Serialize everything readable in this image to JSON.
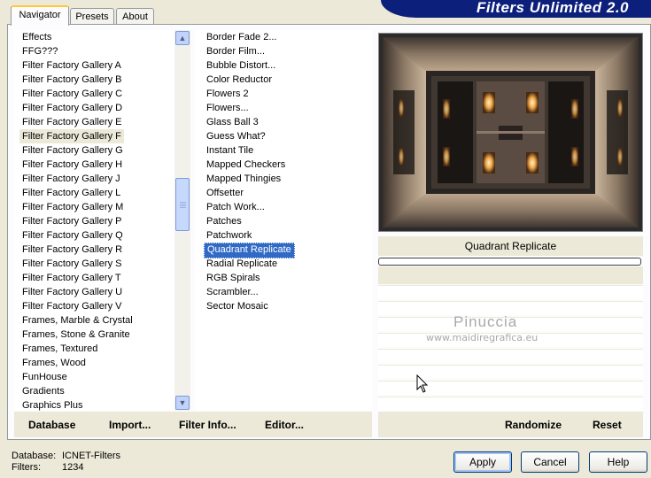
{
  "tabs": [
    {
      "label": "Navigator"
    },
    {
      "label": "Presets"
    },
    {
      "label": "About"
    }
  ],
  "app_title": "Filters Unlimited 2.0",
  "categories": [
    "Effects",
    "FFG???",
    "Filter Factory Gallery A",
    "Filter Factory Gallery B",
    "Filter Factory Gallery C",
    "Filter Factory Gallery D",
    "Filter Factory Gallery E",
    "Filter Factory Gallery F",
    "Filter Factory Gallery G",
    "Filter Factory Gallery H",
    "Filter Factory Gallery J",
    "Filter Factory Gallery L",
    "Filter Factory Gallery M",
    "Filter Factory Gallery P",
    "Filter Factory Gallery Q",
    "Filter Factory Gallery R",
    "Filter Factory Gallery S",
    "Filter Factory Gallery T",
    "Filter Factory Gallery U",
    "Filter Factory Gallery V",
    "Frames, Marble & Crystal",
    "Frames, Stone & Granite",
    "Frames, Textured",
    "Frames, Wood",
    "FunHouse",
    "Gradients",
    "Graphics Plus"
  ],
  "selected_category": "Filter Factory Gallery F",
  "filters": [
    "Border Fade 2...",
    "Border Film...",
    "Bubble Distort...",
    "Color Reductor",
    "Flowers 2",
    "Flowers...",
    "Glass Ball 3",
    "Guess What?",
    "Instant Tile",
    "Mapped Checkers",
    "Mapped Thingies",
    "Offsetter",
    "Patch Work...",
    "Patches",
    "Patchwork",
    "Quadrant Replicate",
    "Radial Replicate",
    "RGB Spirals",
    "Scrambler...",
    "Sector Mosaic"
  ],
  "selected_filter": "Quadrant Replicate",
  "bottom_buttons": {
    "database": "Database",
    "import": "Import...",
    "filter_info": "Filter Info...",
    "editor": "Editor..."
  },
  "preview": {
    "filter_name": "Quadrant Replicate"
  },
  "watermark": {
    "name": "Pinuccia",
    "url": "www.maidiregrafica.eu"
  },
  "right_buttons": {
    "randomize": "Randomize",
    "reset": "Reset"
  },
  "footer": {
    "database_label": "Database:",
    "database_value": "ICNET-Filters",
    "filters_label": "Filters:",
    "filters_value": "1234"
  },
  "dialog_buttons": {
    "apply": "Apply",
    "cancel": "Cancel",
    "help": "Help"
  },
  "colors": {
    "selection": "#316ac5",
    "banner": "#0c1f7a",
    "dialog_bg": "#ece9d8"
  }
}
